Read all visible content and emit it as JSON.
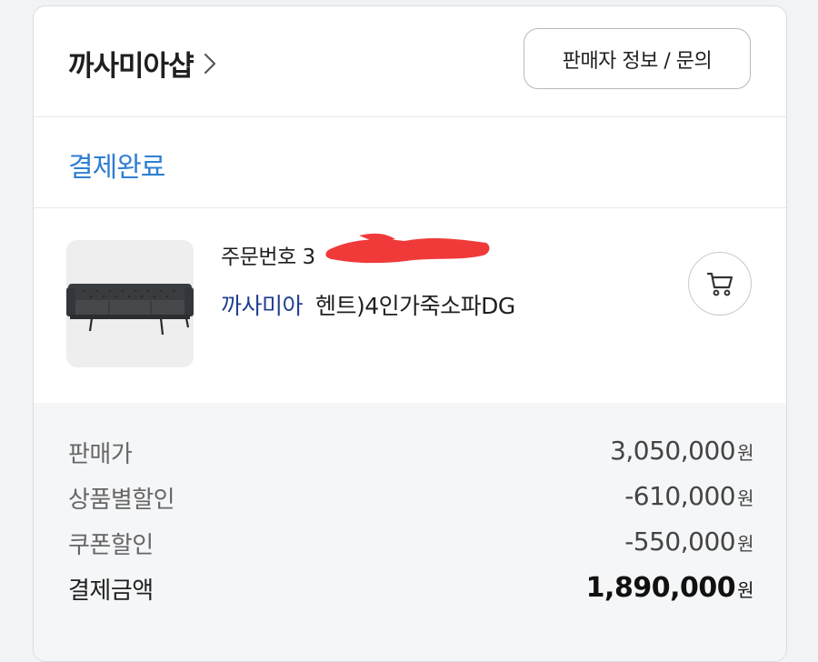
{
  "header": {
    "shop_name": "까사미아샵",
    "seller_button_label": "판매자 정보 / 문의"
  },
  "status": {
    "label": "결제완료",
    "color": "#2f7fd1"
  },
  "product": {
    "order_number_label": "주문번호 3",
    "brand": "까사미아",
    "name": "헨트)4인가죽소파DG",
    "image_icon": "sofa-image"
  },
  "prices": [
    {
      "label": "판매가",
      "value": "3,050,000",
      "unit": "원"
    },
    {
      "label": "상품별할인",
      "value": "-610,000",
      "unit": "원"
    },
    {
      "label": "쿠폰할인",
      "value": "-550,000",
      "unit": "원"
    },
    {
      "label": "결제금액",
      "value": "1,890,000",
      "unit": "원"
    }
  ],
  "colors": {
    "brand_text": "#1f3f8f",
    "redaction": "#f03a3a"
  }
}
